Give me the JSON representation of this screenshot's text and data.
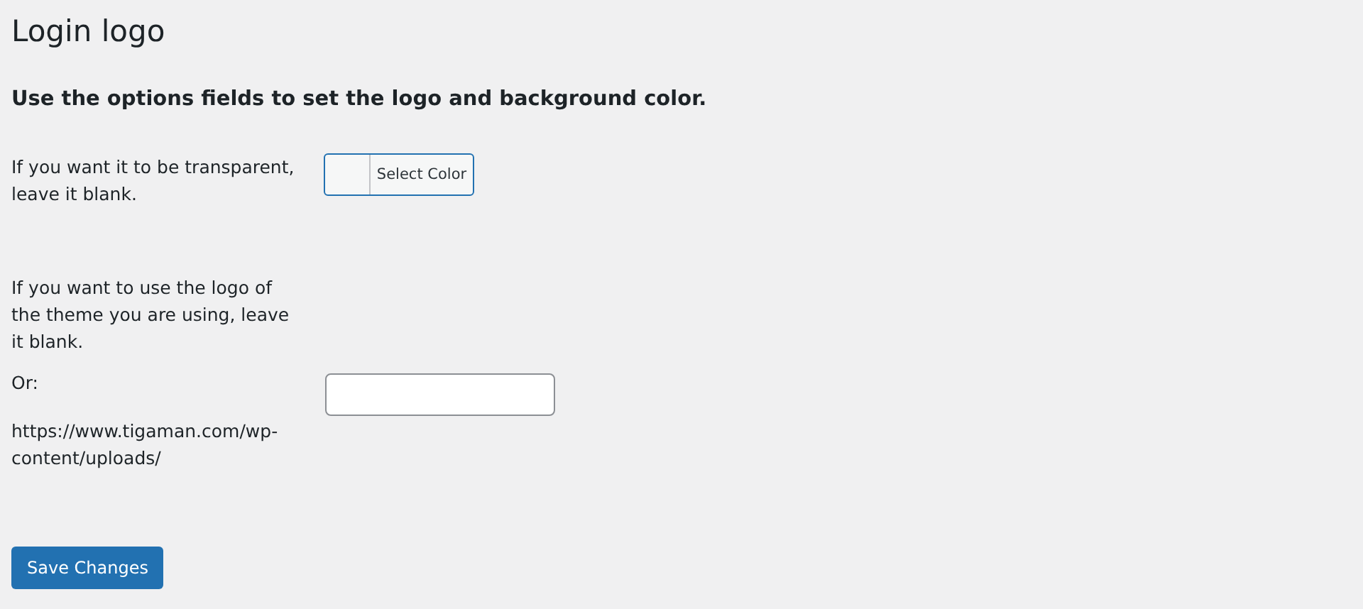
{
  "title": "Login logo",
  "subtitle": "Use the options fields to set the logo and background color.",
  "color_row": {
    "label": "If you want it to be transparent, leave it blank.",
    "button": "Select Color"
  },
  "logo_row": {
    "label": "If you want to use the logo of the theme you are using, leave it blank.",
    "or": "Or:",
    "path": "https://www.tigaman.com/wp-content/uploads/"
  },
  "save_button": "Save Changes"
}
